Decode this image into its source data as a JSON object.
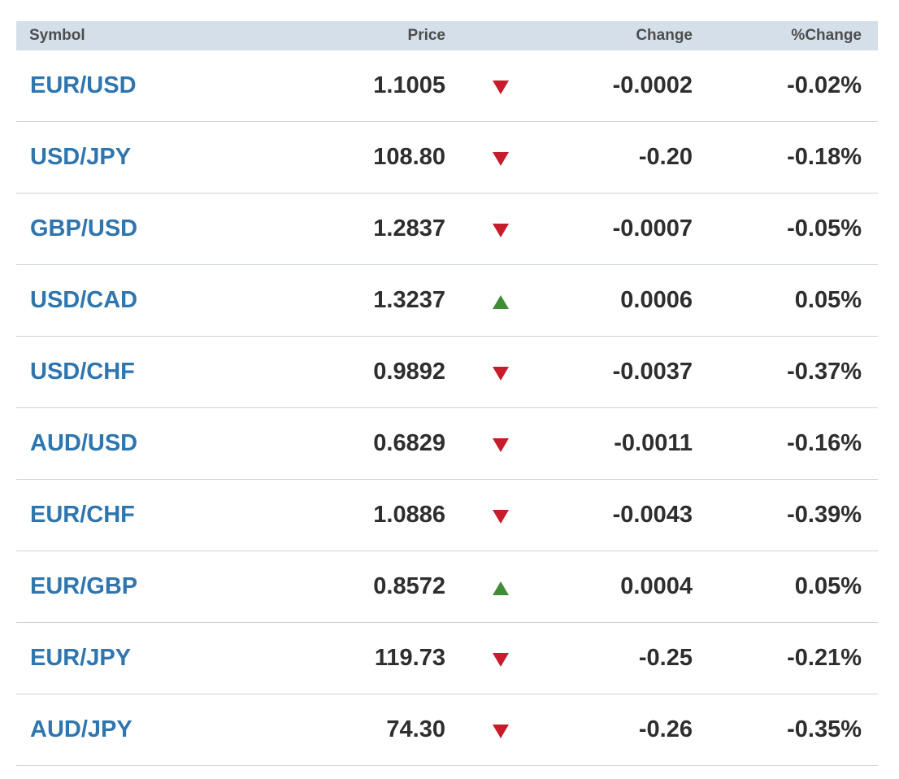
{
  "header": {
    "symbol": "Symbol",
    "price": "Price",
    "change": "Change",
    "pct_change": "%Change"
  },
  "colors": {
    "link": "#2f75ae",
    "down": "#c71c2c",
    "up": "#3f8d36",
    "header_bg": "#d4dfe9"
  },
  "rows": [
    {
      "symbol": "EUR/USD",
      "price": "1.1005",
      "direction": "down",
      "change": "-0.0002",
      "pct_change": "-0.02%"
    },
    {
      "symbol": "USD/JPY",
      "price": "108.80",
      "direction": "down",
      "change": "-0.20",
      "pct_change": "-0.18%"
    },
    {
      "symbol": "GBP/USD",
      "price": "1.2837",
      "direction": "down",
      "change": "-0.0007",
      "pct_change": "-0.05%"
    },
    {
      "symbol": "USD/CAD",
      "price": "1.3237",
      "direction": "up",
      "change": "0.0006",
      "pct_change": "0.05%"
    },
    {
      "symbol": "USD/CHF",
      "price": "0.9892",
      "direction": "down",
      "change": "-0.0037",
      "pct_change": "-0.37%"
    },
    {
      "symbol": "AUD/USD",
      "price": "0.6829",
      "direction": "down",
      "change": "-0.0011",
      "pct_change": "-0.16%"
    },
    {
      "symbol": "EUR/CHF",
      "price": "1.0886",
      "direction": "down",
      "change": "-0.0043",
      "pct_change": "-0.39%"
    },
    {
      "symbol": "EUR/GBP",
      "price": "0.8572",
      "direction": "up",
      "change": "0.0004",
      "pct_change": "0.05%"
    },
    {
      "symbol": "EUR/JPY",
      "price": "119.73",
      "direction": "down",
      "change": "-0.25",
      "pct_change": "-0.21%"
    },
    {
      "symbol": "AUD/JPY",
      "price": "74.30",
      "direction": "down",
      "change": "-0.26",
      "pct_change": "-0.35%"
    }
  ]
}
